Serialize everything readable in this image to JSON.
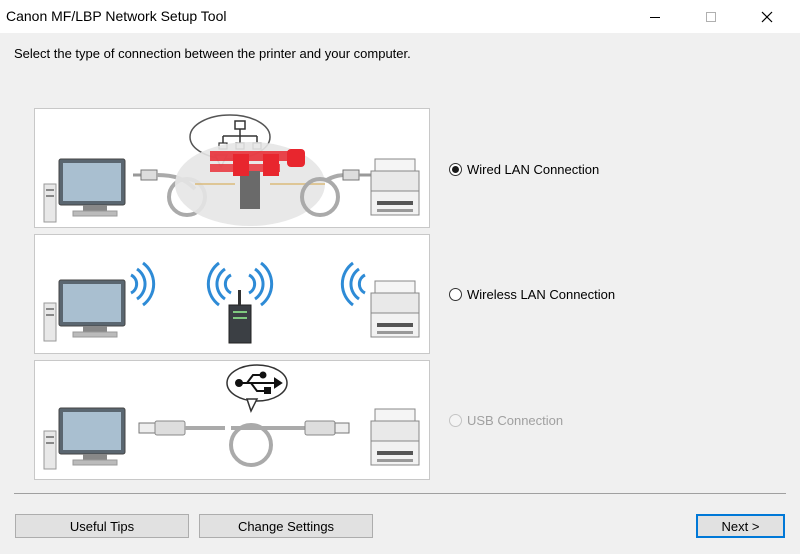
{
  "window": {
    "title": "Canon MF/LBP Network Setup Tool"
  },
  "instruction": "Select the type of connection between the printer and your computer.",
  "options": [
    {
      "label": "Wired LAN Connection",
      "selected": true,
      "enabled": true
    },
    {
      "label": "Wireless LAN Connection",
      "selected": false,
      "enabled": true
    },
    {
      "label": "USB Connection",
      "selected": false,
      "enabled": false
    }
  ],
  "buttons": {
    "useful_tips": "Useful Tips",
    "change_settings": "Change Settings",
    "next": "Next >"
  },
  "colors": {
    "accent": "#0078d7",
    "wave_blue": "#2e8bd6",
    "router_red": "#e8262e"
  },
  "icons": [
    "minimize-icon",
    "maximize-icon",
    "close-icon",
    "computer-icon",
    "printer-icon",
    "router-icon",
    "usb-icon",
    "wifi-signal-icon"
  ]
}
